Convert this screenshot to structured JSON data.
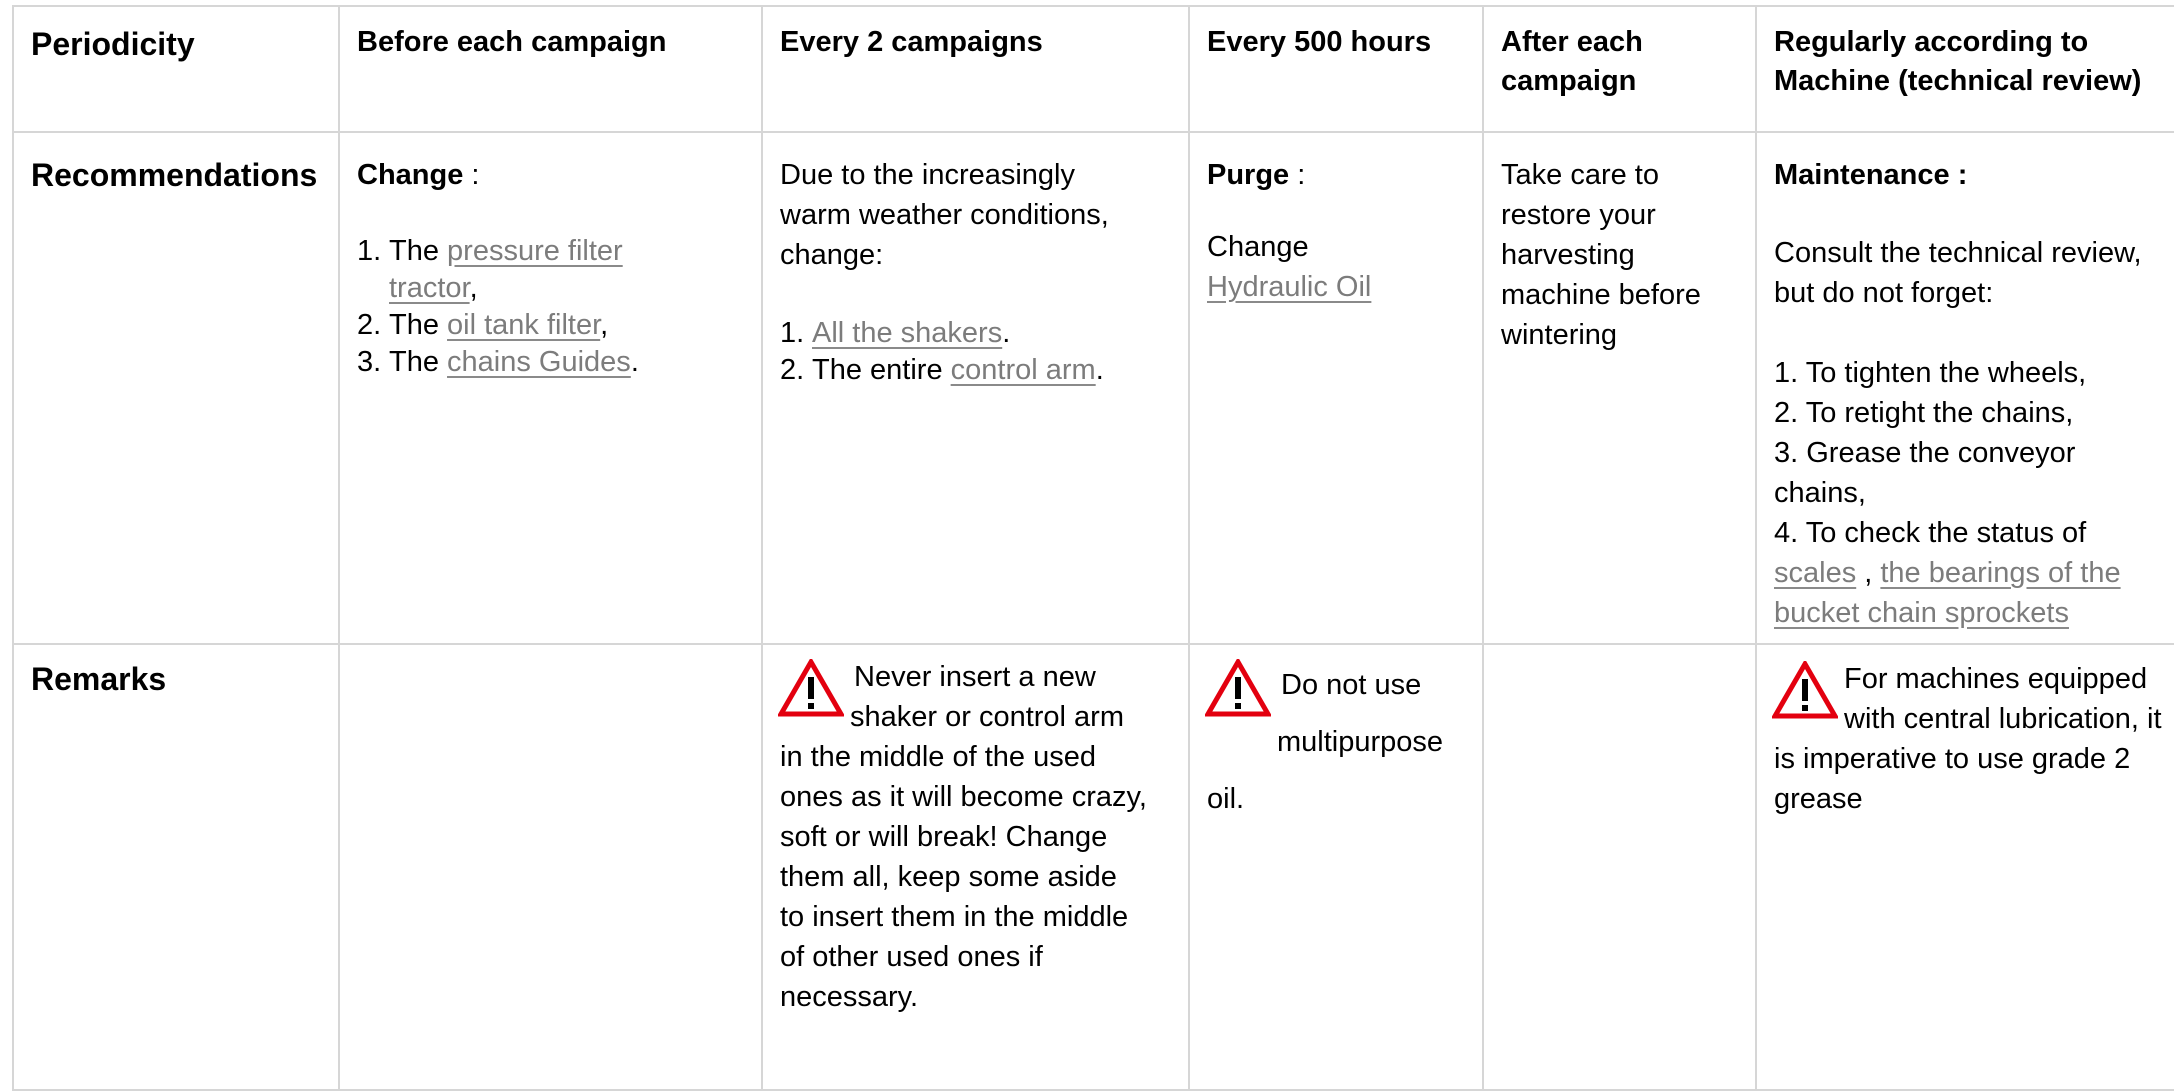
{
  "header": {
    "periodicity": "Periodicity",
    "col1": "Before each campaign",
    "col2": "Every 2 campaigns",
    "col3": "Every 500 hours",
    "col4": "After each campaign",
    "col5": "Regularly according to Machine (technical review)"
  },
  "rows": {
    "recommendations_label": "Recommendations",
    "remarks_label": "Remarks"
  },
  "rec": {
    "col1": {
      "heading": "Change",
      "heading_suffix": " :",
      "items": [
        {
          "num": "1.",
          "prefix": "The ",
          "link": "pressure filter tractor",
          "suffix": ","
        },
        {
          "num": "2.",
          "prefix": "The ",
          "link": "oil tank filter",
          "suffix": ","
        },
        {
          "num": "3.",
          "prefix": "The ",
          "link": "chains Guides",
          "suffix": "."
        }
      ]
    },
    "col2": {
      "intro": "Due to the increasingly warm weather conditions, change:",
      "items": [
        {
          "num": "1.",
          "prefix": "",
          "link": "All the shakers",
          "suffix": "."
        },
        {
          "num": "2.",
          "prefix": "The entire ",
          "link": "control arm",
          "suffix": "."
        }
      ]
    },
    "col3": {
      "heading": "Purge",
      "heading_suffix": " :",
      "line": "Change",
      "link": "Hydraulic Oil"
    },
    "col4": {
      "text": "Take care to restore your harvesting machine before wintering"
    },
    "col5": {
      "heading": "Maintenance :",
      "intro": "Consult the technical review, but do not forget:",
      "items": [
        "1. To tighten the wheels,",
        "2. To retight the chains,",
        "3. Grease the conveyor chains,"
      ],
      "item4_text": "4. To check the status of",
      "item4_link1": "scales",
      "item4_sep": " , ",
      "item4_link2": "the bearings of the bucket chain sprockets"
    }
  },
  "remarks": {
    "col2": "Never insert a new shaker or control arm in the middle of the used ones as it will become crazy, soft or will break! Change them all, keep some aside to insert them in the middle of other used ones if necessary.",
    "col3": "Do not use multipurpose oil.",
    "col5": "For machines equipped with central lubrication, it is imperative to use grade 2 grease"
  },
  "colors": {
    "link": "#7c7c7c",
    "border": "#d6d6d6",
    "warning_red": "#e3000f"
  },
  "icons": {
    "warning": "warning-triangle-icon"
  }
}
